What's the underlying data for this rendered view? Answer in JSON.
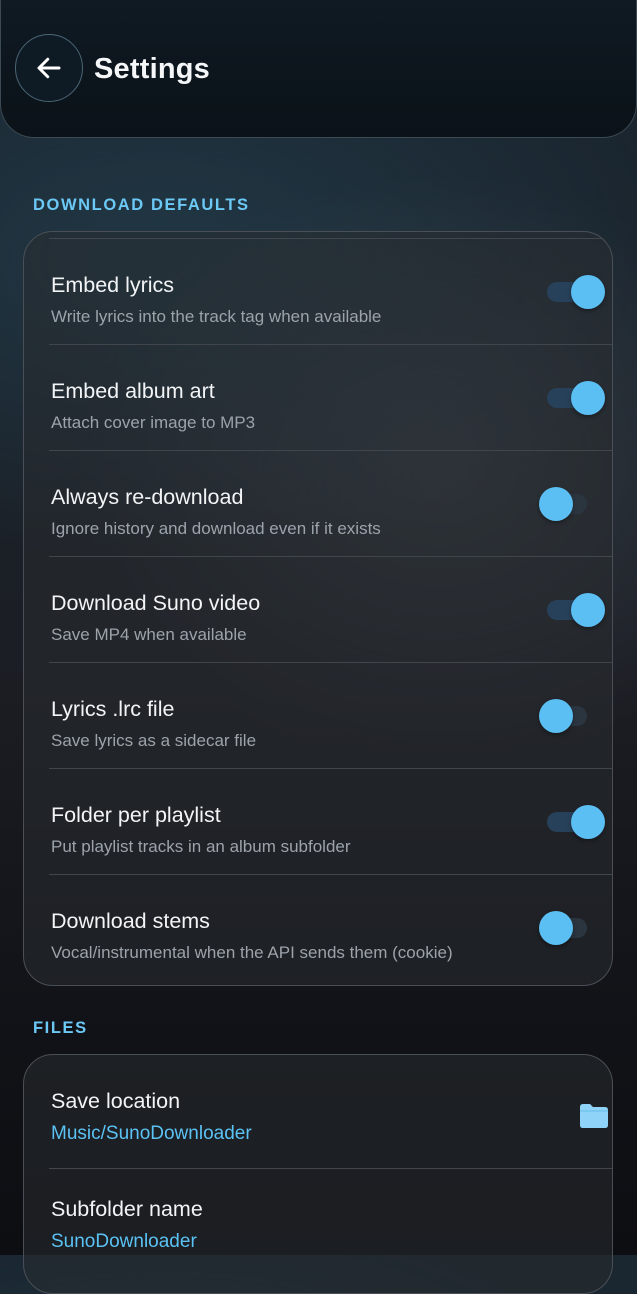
{
  "header": {
    "title": "Settings"
  },
  "download_defaults": {
    "section_label": "DOWNLOAD DEFAULTS",
    "items": [
      {
        "title": "Embed lyrics",
        "subtitle": "Write lyrics into the track tag when available",
        "enabled": true
      },
      {
        "title": "Embed album art",
        "subtitle": "Attach cover image to MP3",
        "enabled": true
      },
      {
        "title": "Always re-download",
        "subtitle": "Ignore history and download even if it exists",
        "enabled": false
      },
      {
        "title": "Download Suno video",
        "subtitle": "Save MP4 when available",
        "enabled": true
      },
      {
        "title": "Lyrics .lrc file",
        "subtitle": "Save lyrics as a sidecar file",
        "enabled": false
      },
      {
        "title": "Folder per playlist",
        "subtitle": "Put playlist tracks in an album subfolder",
        "enabled": true
      },
      {
        "title": "Download stems",
        "subtitle": "Vocal/instrumental when the API sends them (cookie)",
        "enabled": false
      }
    ]
  },
  "files": {
    "section_label": "FILES",
    "save_location": {
      "title": "Save location",
      "value": "Music/SunoDownloader"
    },
    "subfolder": {
      "title": "Subfolder name",
      "value": "SunoDownloader"
    }
  },
  "colors": {
    "accent": "#5bbff4",
    "section_header": "#6cc8f5",
    "card_border": "#4a4f57"
  }
}
